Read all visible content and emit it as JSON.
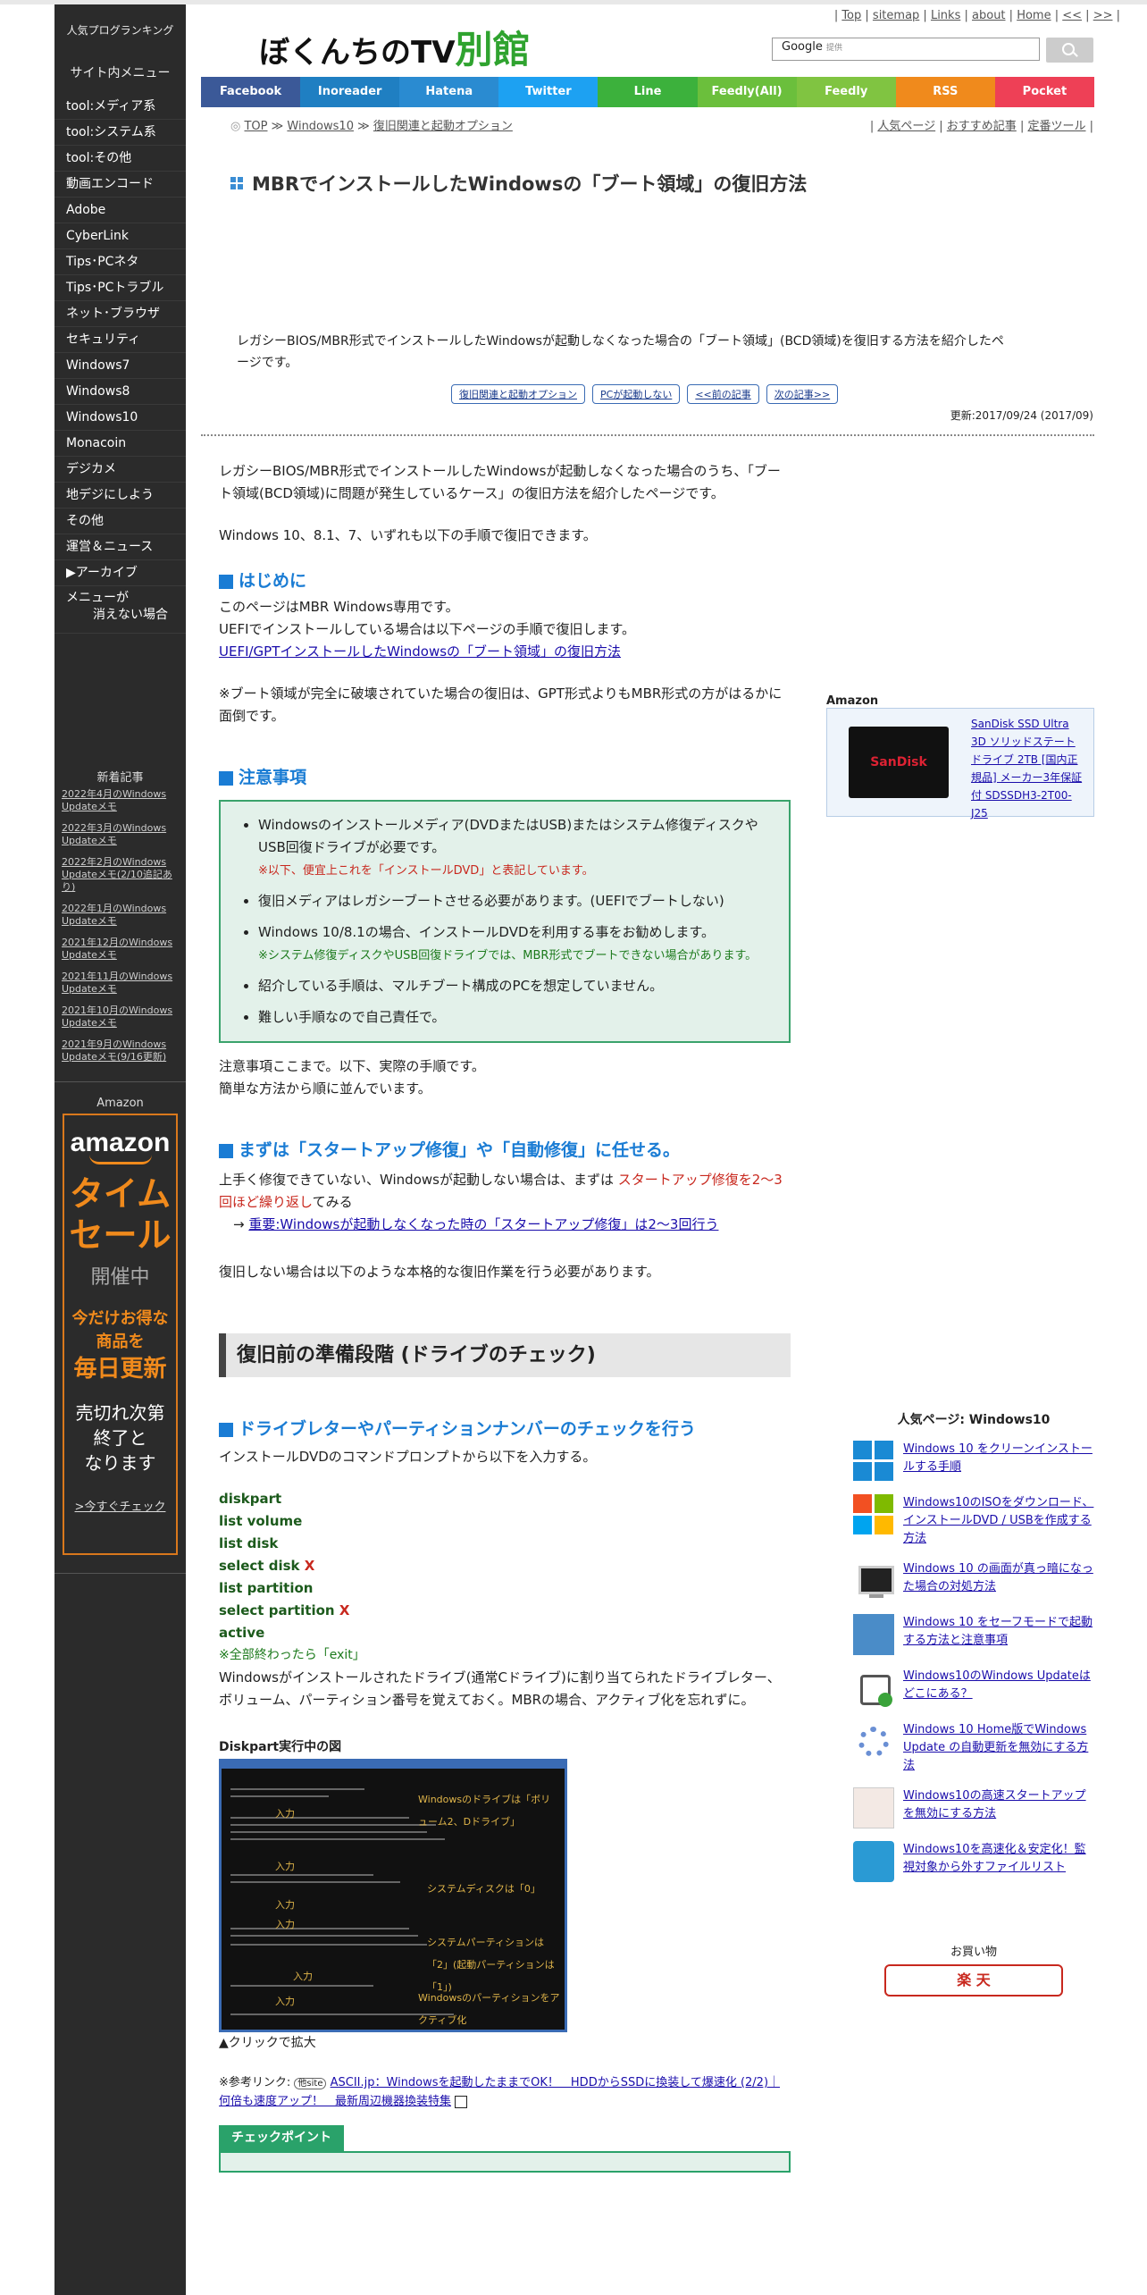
{
  "header": {
    "logo_main": "ぼくんちのTV",
    "logo_accent": "別館",
    "top_links": [
      "Top",
      "sitemap",
      "Links",
      "about",
      "Home",
      "<<",
      ">>"
    ],
    "search_brand": "Google",
    "search_sub": "提供"
  },
  "nav": [
    {
      "label": "Facebook",
      "color": "#3b5998"
    },
    {
      "label": "Inoreader",
      "color": "#1f7fc2"
    },
    {
      "label": "Hatena",
      "color": "#2a8bd1"
    },
    {
      "label": "Twitter",
      "color": "#1da1f2"
    },
    {
      "label": "Line",
      "color": "#3cb13c"
    },
    {
      "label": "Feedly(All)",
      "color": "#6bbf3c"
    },
    {
      "label": "Feedly",
      "color": "#80c441"
    },
    {
      "label": "RSS",
      "color": "#f08a1c"
    },
    {
      "label": "Pocket",
      "color": "#ee4056"
    }
  ],
  "sidebar": {
    "head": "人気プログランキング",
    "menu_title": "サイト内メニュー",
    "items": [
      "tool:メディア系",
      "tool:システム系",
      "tool:その他",
      "動画エンコード",
      "Adobe",
      "CyberLink",
      "Tips･PCネタ",
      "Tips･PCトラブル",
      "ネット･ブラウザ",
      "セキュリティ",
      "Windows7",
      "Windows8",
      "Windows10",
      "Monacoin",
      "デジカメ",
      "地デジにしよう",
      "その他",
      "運営＆ニュース",
      "▶アーカイブ"
    ],
    "last_item_1": "メニューが",
    "last_item_2": "消えない場合",
    "news_title": "新着記事",
    "news": [
      "2022年4月のWindows Updateメモ",
      "2022年3月のWindows Updateメモ",
      "2022年2月のWindows Updateメモ(2/10追記あり)",
      "2022年1月のWindows Updateメモ",
      "2021年12月のWindows Updateメモ",
      "2021年11月のWindows Updateメモ",
      "2021年10月のWindows Updateメモ",
      "2021年9月のWindows Updateメモ(9/16更新)"
    ],
    "amazon_label": "Amazon",
    "ad": {
      "logo": "amazon",
      "line1": "タイム",
      "line2": "セール",
      "line3": "開催中",
      "line4": "今だけお得な",
      "line5": "商品を",
      "line6": "毎日更新",
      "line7": "売切れ次第",
      "line8": "終了と",
      "line9": "なります",
      "check": ">今すぐチェック"
    }
  },
  "breadcrumb": {
    "icon": "◎",
    "items": [
      "TOP",
      "Windows10",
      "復旧関連と起動オプション"
    ],
    "sep": "≫"
  },
  "toolbox": [
    "人気ページ",
    "おすすめ記事",
    "定番ツール"
  ],
  "title": "MBRでインストールしたWindowsの「ブート領域」の復旧方法",
  "intro": "レガシーBIOS/MBR形式でインストールしたWindowsが起動しなくなった場合の「ブート領域」(BCD領域)を復旧する方法を紹介したページです。",
  "buttons": [
    "復旧関連と起動オプション",
    "PCが起動しない",
    "<<前の記事",
    "次の記事>>"
  ],
  "updated": "更新:2017/09/24 (2017/09)",
  "main": {
    "p1": "レガシーBIOS/MBR形式でインストールしたWindowsが起動しなくなった場合のうち、「ブート領域(BCD領域)に問題が発生しているケース」の復旧方法を紹介したページです。",
    "p2": "Windows 10、8.1、7、いずれも以下の手順で復旧できます。",
    "h_intro": "はじめに",
    "intro1": "このページはMBR Windows専用です。",
    "intro2": "UEFIでインストールしている場合は以下ページの手順で復旧します。",
    "intro_link": "UEFI/GPTインストールしたWindowsの「ブート領域」の復旧方法",
    "intro3": "※ブート領域が完全に破壊されていた場合の復旧は、GPT形式よりもMBR形式の方がはるかに面倒です。",
    "h_caution": "注意事項",
    "c1": "Windowsのインストールメディア(DVDまたはUSB)またはシステム修復ディスクやUSB回復ドライブが必要です。",
    "c1_note": "※以下、便宜上これを「インストールDVD」と表記しています。",
    "c2": "復旧メディアはレガシーブートさせる必要があります。(UEFIでブートしない)",
    "c3": "Windows 10/8.1の場合、インストールDVDを利用する事をお勧めします。",
    "c3_note": "※システム修復ディスクやUSB回復ドライブでは、MBR形式でブートできない場合があります。",
    "c4": "紹介している手順は、マルチブート構成のPCを想定していません。",
    "c5": "難しい手順なので自己責任で。",
    "after1": "注意事項ここまで。以下、実際の手順です。",
    "after2": "簡単な方法から順に並んでいます。",
    "h_startup": "まずは「スタートアップ修復」や「自動修復」に任せる。",
    "s1a": "上手く修復できていない、Windowsが起動しない場合は、まずは ",
    "s1b": "スタートアップ修復を2～3回ほど繰り返し",
    "s1c": "てみる",
    "s_arrow": "→",
    "s_link": "重要:Windowsが起動しなくなった時の「スタートアップ修復」は2～3回行う",
    "s2": "復旧しない場合は以下のような本格的な復旧作業を行う必要があります。",
    "big_h": "復旧前の準備段階 (ドライブのチェック)",
    "h_drive": "ドライブレターやパーティションナンバーのチェックを行う",
    "d1": "インストールDVDのコマンドプロンプトから以下を入力する。",
    "cmds": [
      "diskpart",
      "list volume",
      "list disk",
      "select disk",
      "list partition",
      "select partition",
      "active"
    ],
    "x": "X",
    "cmd_end": "※全部終わったら「exit」",
    "d2": "Windowsがインストールされたドライブ(通常Cドライブ)に割り当てられたドライブレター、ボリューム、パーティション番号を覚えておく。MBRの場合、アクティブ化を忘れずに。",
    "fig_title": "Diskpart実行中の図",
    "fig_labels": [
      "Windowsのドライブは「ボリューム2、Dドライブ」",
      "入力",
      "入力",
      "システムディスクは「0」",
      "入力",
      "入力",
      "システムパーティションは「2」(起動パーティションは「1」)",
      "入力",
      "入力",
      "Windowsのパーティションをアクティブ化"
    ],
    "fig_caption": "▲クリックで拡大",
    "ref_prefix": "※参考リンク:",
    "ref_badge": "他site",
    "ref_link": "ASCII.jp：Windowsを起動したままでOK！　HDDからSSDに換装して爆速化 (2/2)｜何倍も速度アップ！　最新周辺機器換装特集",
    "check_tag": "チェックポイント"
  },
  "right": {
    "amazon_title": "Amazon",
    "ssd_brand": "SanDisk",
    "ssd_desc": "SanDisk SSD Ultra 3D ソリッドステートドライブ 2TB [国内正規品] メーカー3年保証付 SDSSDH3-2T00-J25",
    "popular_title": "人気ページ: Windows10",
    "popular": [
      {
        "text": "Windows 10 をクリーンインストールする手順",
        "icon": "windows-logo-icon"
      },
      {
        "text": "Windows10のISOをダウンロード、インストールDVD / USBを作成する方法",
        "icon": "windows-color-icon"
      },
      {
        "text": "Windows 10 の画面が真っ暗になった場合の対処方法",
        "icon": "monitor-icon"
      },
      {
        "text": "Windows 10 をセーフモードで起動する方法と注意事項",
        "icon": "safe-mode-icon"
      },
      {
        "text": "Windows10のWindows Updateはどこにある？",
        "icon": "update-icon"
      },
      {
        "text": "Windows 10 Home版でWindows Update の自動更新を無効にする方法",
        "icon": "gear-icon"
      },
      {
        "text": "Windows10の高速スタートアップを無効にする方法",
        "icon": "startup-icon"
      },
      {
        "text": "Windows10を高速化＆安定化！監視対象から外すファイルリスト",
        "icon": "tools-icon"
      }
    ],
    "buy_label": "お買い物",
    "rakuten": "楽 天"
  }
}
